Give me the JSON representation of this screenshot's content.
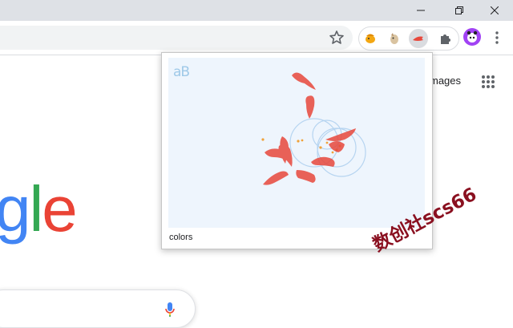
{
  "browser": {
    "extension_popup_label": "colors"
  },
  "page": {
    "images_link": "mages",
    "logo_letters": [
      {
        "char": "g",
        "color": "#4285f4"
      },
      {
        "char": "l",
        "color": "#34a853"
      },
      {
        "char": "e",
        "color": "#ea4335"
      }
    ]
  },
  "popup": {
    "logo": "aB",
    "label": "colors"
  },
  "watermark": "数创社scs66",
  "colors": {
    "titlebar": "#dee1e6",
    "fish": "#e8483c",
    "canvas_bg": "#eef5fd"
  }
}
